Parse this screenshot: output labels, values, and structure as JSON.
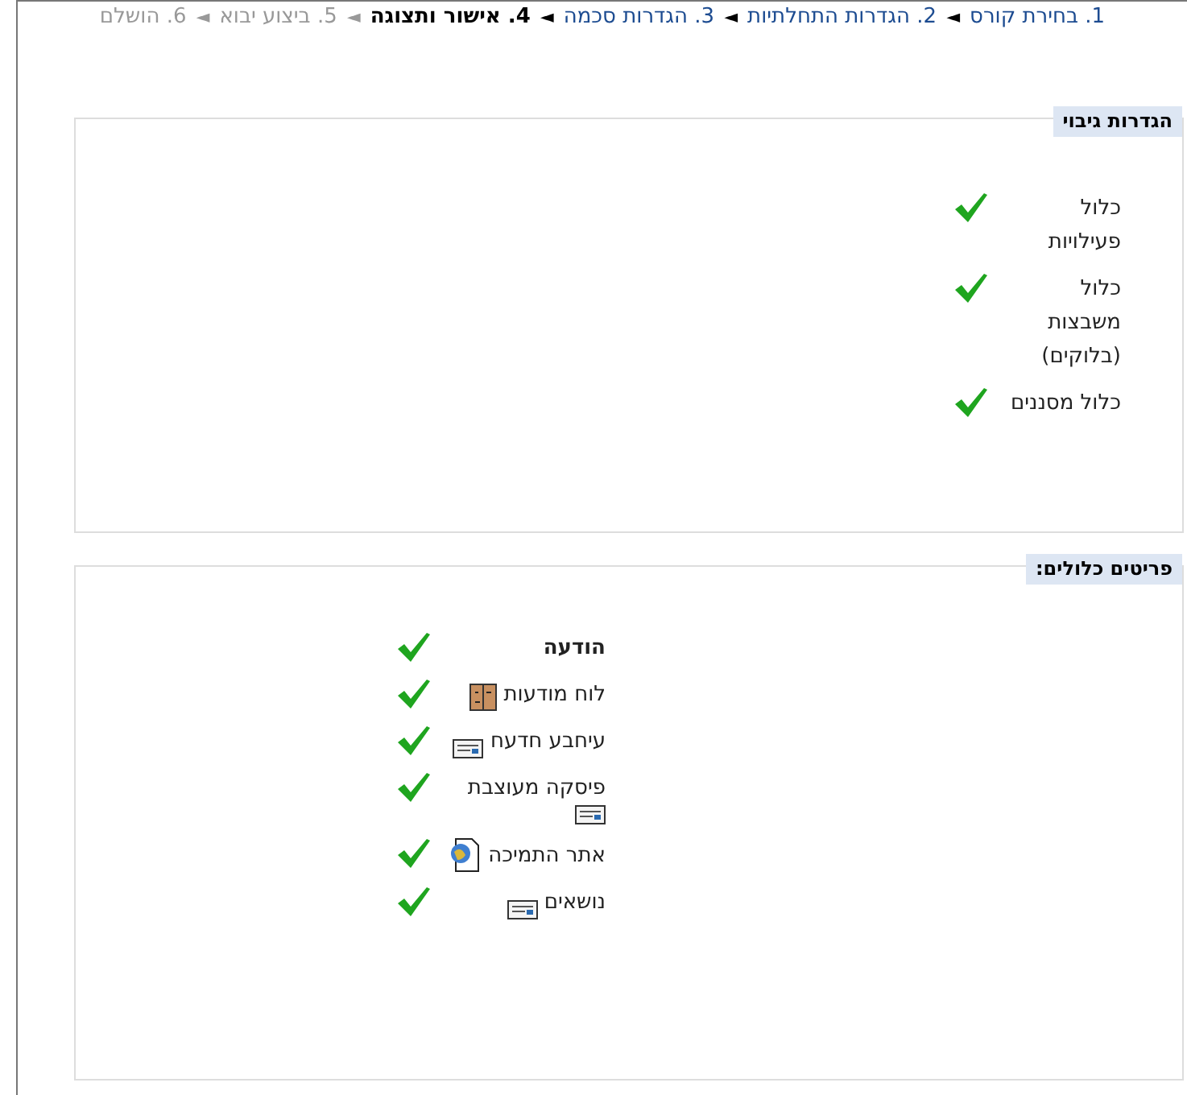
{
  "steps": [
    {
      "number": "1.",
      "label": "בחירת קורס",
      "link": true,
      "selected": false
    },
    {
      "number": "2.",
      "label": "הגדרות התחלתיות",
      "link": true,
      "selected": false
    },
    {
      "number": "3.",
      "label": "הגדרות סכמה",
      "link": true,
      "selected": false
    },
    {
      "number": "4.",
      "label": "אישור ותצוגה",
      "link": false,
      "selected": true
    },
    {
      "number": "5.",
      "label": "ביצוע יבוא",
      "link": false,
      "selected": false
    },
    {
      "number": "6.",
      "label": "הושלם",
      "link": false,
      "selected": false
    }
  ],
  "separator": "◄",
  "backup_settings": {
    "legend": "הגדרות גיבוי",
    "items": [
      {
        "label": "כלול פעילויות",
        "included": true
      },
      {
        "label": "כלול משבצות (בלוקים)",
        "included": true
      },
      {
        "label": "כלול מסננים",
        "included": true
      }
    ]
  },
  "included_items": {
    "legend": "פריטים כלולים:",
    "items": [
      {
        "label": "הודעה",
        "kind": "heading",
        "included": true
      },
      {
        "label": "לוח מודעות",
        "kind": "board",
        "included": true
      },
      {
        "label": "עיחבע חדעח",
        "kind": "card",
        "included": true
      },
      {
        "label": "פיסקה מעוצבת",
        "kind": "card",
        "included": true
      },
      {
        "label": "אתר התמיכה",
        "kind": "web",
        "included": true
      },
      {
        "label": "נושאים",
        "kind": "card",
        "included": true
      }
    ]
  }
}
